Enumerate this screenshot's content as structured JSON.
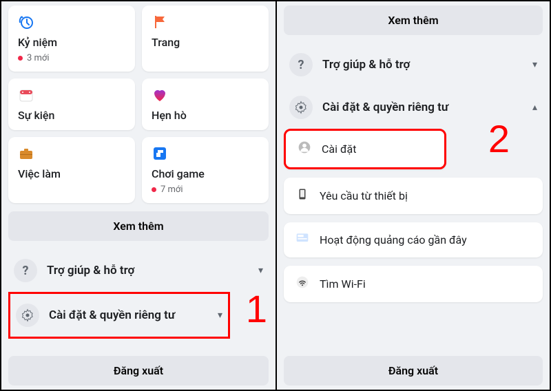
{
  "left": {
    "cards": [
      {
        "label": "Kỷ niệm",
        "badge": "3 mới",
        "has_badge": true
      },
      {
        "label": "Trang",
        "badge": "",
        "has_badge": false
      },
      {
        "label": "Sự kiện",
        "badge": "",
        "has_badge": false
      },
      {
        "label": "Hẹn hò",
        "badge": "",
        "has_badge": false
      },
      {
        "label": "Việc làm",
        "badge": "",
        "has_badge": false
      },
      {
        "label": "Chơi game",
        "badge": "7 mới",
        "has_badge": true
      }
    ],
    "see_more": "Xem thêm",
    "help_row": "Trợ giúp & hỗ trợ",
    "settings_row": "Cài đặt & quyền riêng tư",
    "logout": "Đăng xuất",
    "step": "1"
  },
  "right": {
    "see_more": "Xem thêm",
    "help_row": "Trợ giúp & hỗ trợ",
    "settings_row": "Cài đặt & quyền riêng tư",
    "subitems": [
      "Cài đặt",
      "Yêu cầu từ thiết bị",
      "Hoạt động quảng cáo gần đây",
      "Tìm Wi-Fi"
    ],
    "logout": "Đăng xuất",
    "step": "2"
  }
}
